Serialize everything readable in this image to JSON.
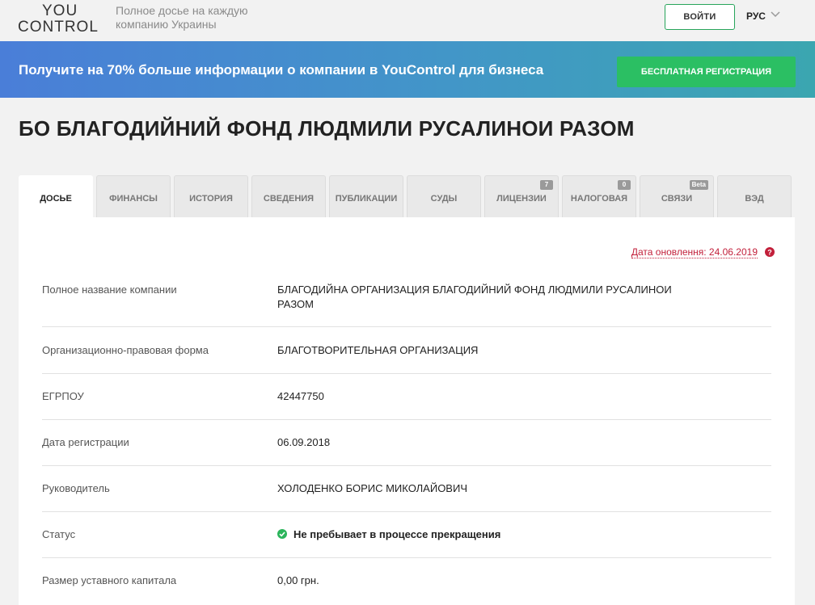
{
  "header": {
    "logo_top": "YOU",
    "logo_bottom": "CONTROL",
    "tagline": "Полное досье на каждую компанию Украины",
    "login_label": "ВОЙТИ",
    "language": "РУС"
  },
  "banner": {
    "text": "Получите на 70% больше информации о компании в YouControl для бизнеса",
    "cta_label": "БЕСПЛАТНАЯ РЕГИСТРАЦИЯ"
  },
  "page_title": "БО БЛАГОДИЙНИЙ ФОНД ЛЮДМИЛИ РУСАЛИНОИ РАЗОМ",
  "tabs": [
    {
      "label": "ДОСЬЕ",
      "active": true
    },
    {
      "label": "ФИНАНСЫ"
    },
    {
      "label": "ИСТОРИЯ"
    },
    {
      "label": "СВЕДЕНИЯ"
    },
    {
      "label": "ПУБЛИКАЦИИ"
    },
    {
      "label": "СУДЫ"
    },
    {
      "label": "ЛИЦЕНЗИИ",
      "badge": "7"
    },
    {
      "label": "НАЛОГОВАЯ",
      "badge": "0"
    },
    {
      "label": "СВЯЗИ",
      "badge": "Beta"
    },
    {
      "label": "ВЭД"
    }
  ],
  "update_text": "Дата оновлення: 24.06.2019",
  "rows": [
    {
      "label": "Полное название компании",
      "value": "БЛАГОДИЙНА ОРГАНИЗАЦИЯ БЛАГОДИЙНИЙ ФОНД ЛЮДМИЛИ РУСАЛИНОИ РАЗОМ"
    },
    {
      "label": "Организационно-правовая форма",
      "value": "БЛАГОТВОРИТЕЛЬНАЯ ОРГАНИЗАЦИЯ"
    },
    {
      "label": "ЕГРПОУ",
      "value": "42447750"
    },
    {
      "label": "Дата регистрации",
      "value": "06.09.2018"
    },
    {
      "label": "Руководитель",
      "value": "ХОЛОДЕНКО БОРИС МИКОЛАЙОВИЧ"
    },
    {
      "label": "Статус",
      "value": "Не пребывает в процессе прекращения"
    },
    {
      "label": "Размер уставного капитала",
      "value": "0,00 грн."
    }
  ],
  "colors": {
    "accent_green": "#2bbf63",
    "alert_red": "#c21f3a",
    "banner_start": "#4a7ed8",
    "banner_end": "#3ba6b0"
  }
}
